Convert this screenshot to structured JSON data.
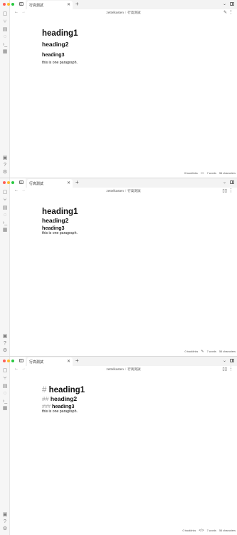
{
  "app": {
    "tab_title": "行高測試",
    "breadcrumb_vault": "zettelkasten",
    "breadcrumb_sep": "/",
    "breadcrumb_note": "行高測試"
  },
  "icons": {
    "sidebar_toggle": "sidebar-left-icon",
    "tab_close": "close-icon",
    "new_tab": "plus-icon",
    "ribbon": [
      "file-icon",
      "graph-icon",
      "calendar-icon",
      "canvas-icon",
      "terminal-icon",
      "templates-icon"
    ],
    "ribbon_bottom": [
      "vault-icon",
      "help-icon",
      "settings-icon"
    ]
  },
  "status_words": "7 words",
  "status_chars": "56 characters",
  "status_backlinks": "0 backlinks",
  "panes": [
    {
      "mode": "live-preview",
      "h1": "heading1",
      "h2": "heading2",
      "h3": "heading3",
      "para": "this is one paragraph.",
      "mode_icon": "edit-pencil-icon",
      "status_mode_icon": "book-icon"
    },
    {
      "mode": "reading",
      "h1": "heading1",
      "h2": "heading2",
      "h3": "heading3",
      "para": "this is one paragraph.",
      "mode_icon": "book-open-icon",
      "status_mode_icon": "pencil-icon"
    },
    {
      "mode": "source",
      "h1_mark": "#",
      "h2_mark": "##",
      "h3_mark": "###",
      "h1": "heading1",
      "h2": "heading2",
      "h3": "heading3",
      "para": "this is one paragraph.",
      "mode_icon": "book-open-icon",
      "status_mode_icon": "code-icon"
    }
  ]
}
